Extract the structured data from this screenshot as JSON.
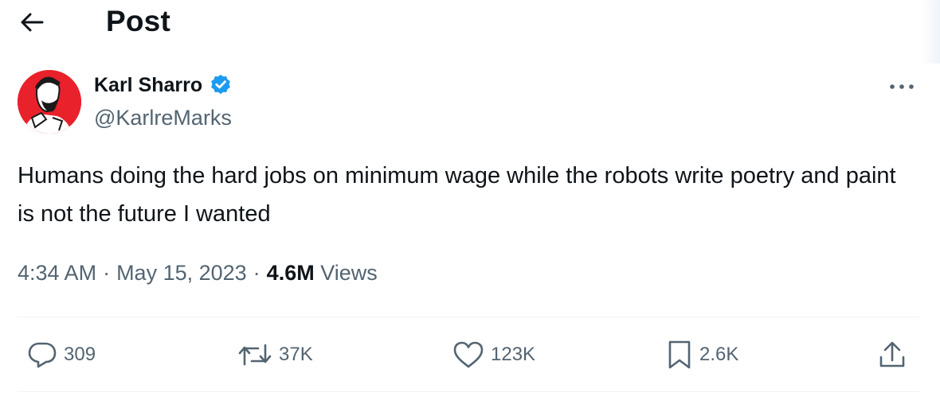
{
  "header": {
    "title": "Post",
    "back_icon": "arrow-left-icon"
  },
  "author": {
    "display_name": "Karl Sharro",
    "handle": "@KarlreMarks",
    "verified": true,
    "verified_color": "#1d9bf0",
    "avatar_bg": "#e8212b"
  },
  "post": {
    "text": "Humans doing the hard jobs on minimum wage while the robots write poetry and paint is not the future I wanted",
    "time": "4:34 AM",
    "date": "May 15, 2023",
    "separator": "·",
    "views_count": "4.6M",
    "views_label": "Views"
  },
  "actions": {
    "replies": "309",
    "reposts": "37K",
    "likes": "123K",
    "bookmarks": "2.6K"
  },
  "colors": {
    "text_primary": "#0f1419",
    "text_secondary": "#536471",
    "divider": "#eff3f4"
  }
}
